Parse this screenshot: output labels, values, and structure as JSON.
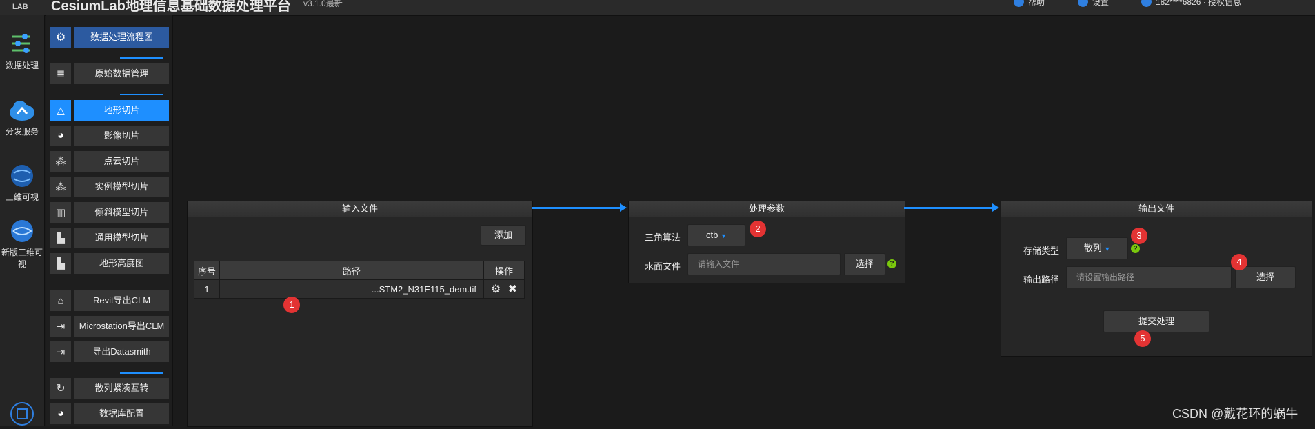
{
  "header": {
    "logo": "LAB",
    "title": "CesiumLab地理信息基础数据处理平台",
    "version": "v3.1.0最新",
    "items": [
      "帮助",
      "设置",
      "182****6826 · 授权信息"
    ]
  },
  "leftnav": [
    {
      "label": "数据处理",
      "icon": "data-processing-icon"
    },
    {
      "label": "分发服务",
      "icon": "cloud-service-icon"
    },
    {
      "label": "三维可视",
      "icon": "earthsdk-globe-icon"
    },
    {
      "label": "新版三维可视",
      "icon": "new-earth-globe-icon"
    }
  ],
  "funcmenu": [
    {
      "label": "数据处理流程图",
      "icon": "gear-icon"
    },
    {
      "label": "原始数据管理",
      "icon": "database-icon"
    },
    {
      "label": "地形切片",
      "icon": "terrain-icon"
    },
    {
      "label": "影像切片",
      "icon": "image-globe-icon"
    },
    {
      "label": "点云切片",
      "icon": "point-cloud-icon"
    },
    {
      "label": "实例模型切片",
      "icon": "instance-model-icon"
    },
    {
      "label": "倾斜模型切片",
      "icon": "oblique-model-icon"
    },
    {
      "label": "通用模型切片",
      "icon": "building-icon"
    },
    {
      "label": "地形高度图",
      "icon": "height-map-icon"
    },
    {
      "label": "Revit导出CLM",
      "icon": "revit-icon"
    },
    {
      "label": "Microstation导出CLM",
      "icon": "export-icon"
    },
    {
      "label": "导出Datasmith",
      "icon": "export-icon"
    },
    {
      "label": "散列紧凑互转",
      "icon": "convert-icon"
    },
    {
      "label": "数据库配置",
      "icon": "database-globe-icon"
    }
  ],
  "input_panel": {
    "title": "输入文件",
    "add_button": "添加",
    "columns": [
      "序号",
      "路径",
      "操作"
    ],
    "rows": [
      {
        "index": "1",
        "path": "...STM2_N31E115_dem.tif"
      }
    ]
  },
  "params_panel": {
    "title": "处理参数",
    "triangle_label": "三角算法",
    "triangle_value": "ctb",
    "water_label": "水面文件",
    "water_placeholder": "请输入文件",
    "choose_button": "选择"
  },
  "output_panel": {
    "title": "输出文件",
    "storage_label": "存储类型",
    "storage_value": "散列",
    "path_label": "输出路径",
    "path_placeholder": "请设置输出路径",
    "choose_button": "选择",
    "submit_button": "提交处理"
  },
  "badges": [
    "1",
    "2",
    "3",
    "4",
    "5"
  ],
  "help_glyph": "?",
  "watermark": "CSDN @戴花环的蜗牛",
  "colors": {
    "accent": "#1e8fff",
    "badge": "#e33333",
    "help": "#7ac80d"
  }
}
